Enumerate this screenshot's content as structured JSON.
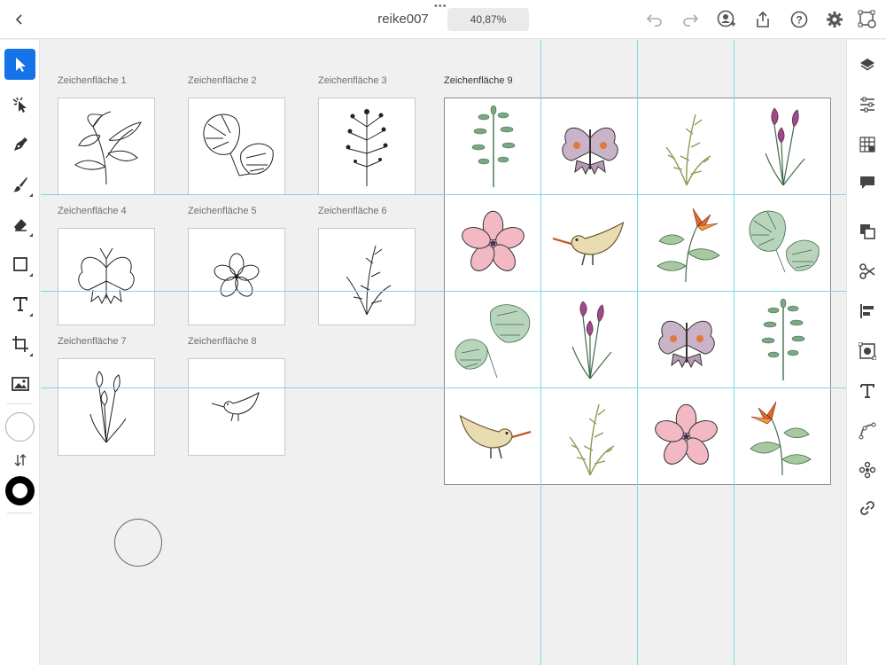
{
  "document": {
    "title": "reike007",
    "zoom": "40,87%"
  },
  "artboards": [
    {
      "label": "Zeichenfläche 1",
      "icon": "plant-sketch"
    },
    {
      "label": "Zeichenfläche 2",
      "icon": "monstera-sketch"
    },
    {
      "label": "Zeichenfläche 3",
      "icon": "herb-sketch"
    },
    {
      "label": "Zeichenfläche 4",
      "icon": "butterfly-sketch"
    },
    {
      "label": "Zeichenfläche 5",
      "icon": "flower-sketch"
    },
    {
      "label": "Zeichenfläche 6",
      "icon": "grass-sketch"
    },
    {
      "label": "Zeichenfläche 7",
      "icon": "tulip-sketch"
    },
    {
      "label": "Zeichenfläche 8",
      "icon": "bird-sketch"
    }
  ],
  "main_artboard": {
    "label": "Zeichenfläche 9",
    "cells": [
      "herb",
      "butterfly",
      "grass",
      "tulip",
      "flower",
      "bird",
      "bird-of-paradise",
      "monstera",
      "monstera",
      "tulip",
      "butterfly",
      "herb",
      "bird",
      "grass",
      "flower",
      "bird-of-paradise"
    ]
  },
  "colors": {
    "accent": "#1473e6",
    "guide": "#7fd8e0",
    "leaf": "#7aa884",
    "pink": "#e79aa8",
    "purple": "#a04a8a",
    "orange": "#e06a2c"
  }
}
